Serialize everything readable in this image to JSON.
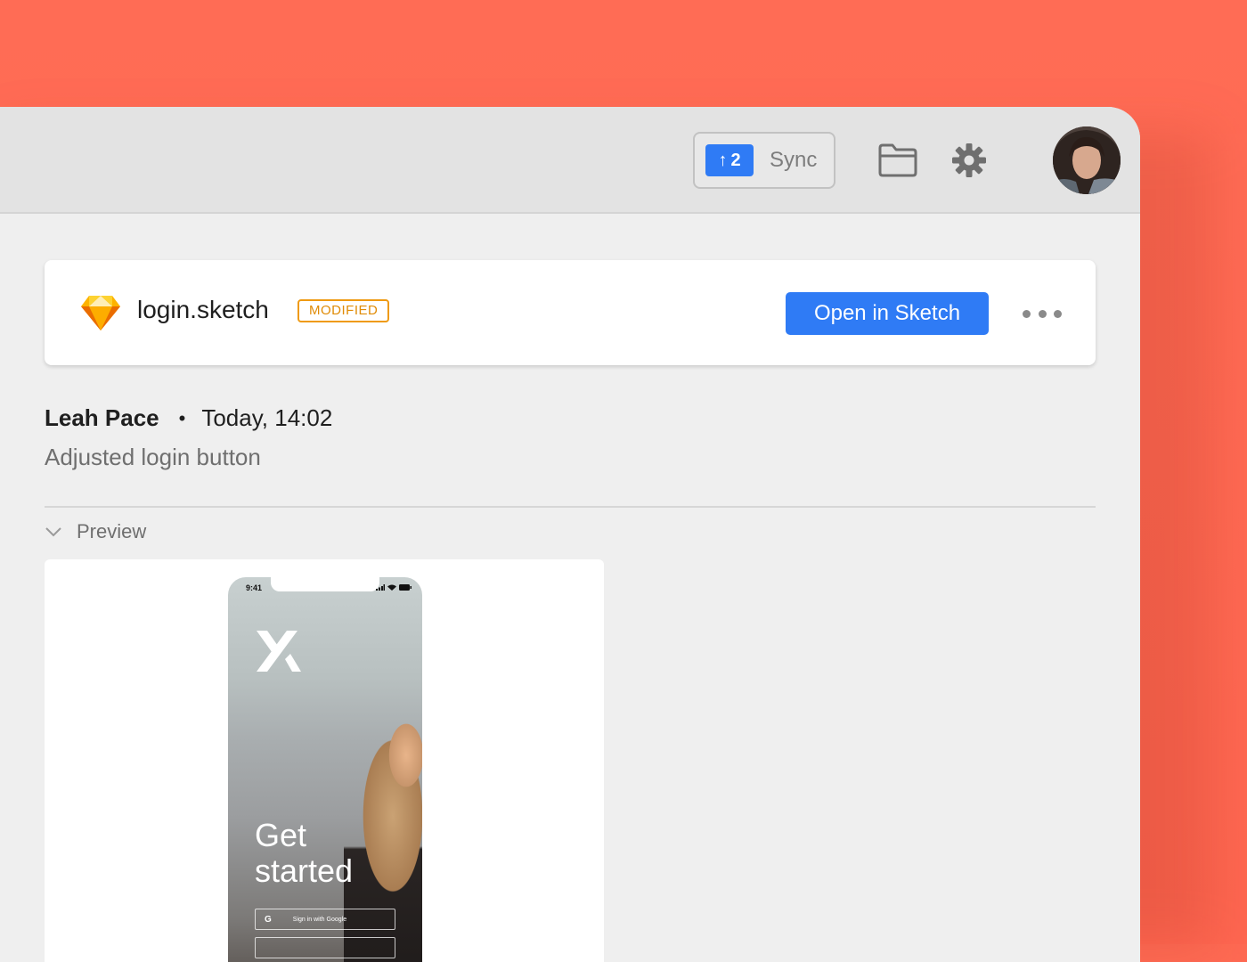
{
  "toolbar": {
    "sync": {
      "count": "2",
      "arrow": "↑",
      "label": "Sync"
    },
    "icons": [
      "folder-icon",
      "gear-icon"
    ],
    "avatar_alt": "user-avatar"
  },
  "file": {
    "name": "login.sketch",
    "status_badge": "MODIFIED",
    "open_button": "Open in Sketch",
    "icon": "sketch-diamond-icon"
  },
  "commit": {
    "author": "Leah Pace",
    "separator": "•",
    "timestamp": "Today, 14:02",
    "message": "Adjusted login button"
  },
  "preview": {
    "label": "Preview",
    "phone": {
      "status_time": "9:41",
      "headline_line1": "Get",
      "headline_line2": "started",
      "google_button_letter": "G",
      "google_button_label": "Sign in with Google"
    }
  },
  "colors": {
    "background": "#fe6a53",
    "accent_blue": "#2f7bf5",
    "badge_orange": "#ef9a12"
  }
}
